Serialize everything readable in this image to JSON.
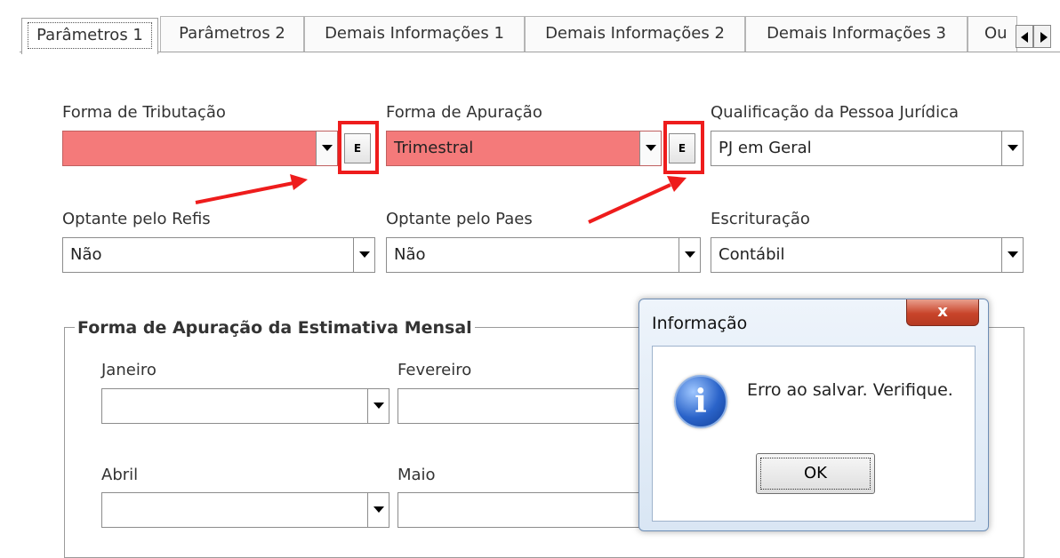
{
  "tabs": [
    {
      "label": "Parâmetros 1",
      "active": true
    },
    {
      "label": "Parâmetros 2",
      "active": false
    },
    {
      "label": "Demais Informações 1",
      "active": false
    },
    {
      "label": "Demais Informações 2",
      "active": false
    },
    {
      "label": "Demais Informações 3",
      "active": false
    },
    {
      "label": "Ou",
      "active": false
    }
  ],
  "fields": {
    "forma_tributacao": {
      "label": "Forma de Tributação",
      "value": "",
      "e_label": "E"
    },
    "forma_apuracao": {
      "label": "Forma de Apuração",
      "value": "Trimestral",
      "e_label": "E"
    },
    "qualificacao": {
      "label": "Qualificação da Pessoa Jurídica",
      "value": "PJ em Geral"
    },
    "optante_refis": {
      "label": "Optante pelo Refis",
      "value": "Não"
    },
    "optante_paes": {
      "label": "Optante pelo Paes",
      "value": "Não"
    },
    "escrituracao": {
      "label": "Escrituração",
      "value": "Contábil"
    }
  },
  "group": {
    "title": "Forma de Apuração da Estimativa Mensal",
    "months": {
      "janeiro": {
        "label": "Janeiro",
        "value": ""
      },
      "fevereiro": {
        "label": "Fevereiro",
        "value": ""
      },
      "abril": {
        "label": "Abril",
        "value": ""
      },
      "maio": {
        "label": "Maio",
        "value": ""
      }
    }
  },
  "dialog": {
    "title": "Informação",
    "close_label": "x",
    "message": "Erro ao salvar. Verifique.",
    "icon_glyph": "i",
    "ok_label": "OK"
  },
  "colors": {
    "error_field": "#f47a7a",
    "highlight_red": "#ee1c1c"
  }
}
